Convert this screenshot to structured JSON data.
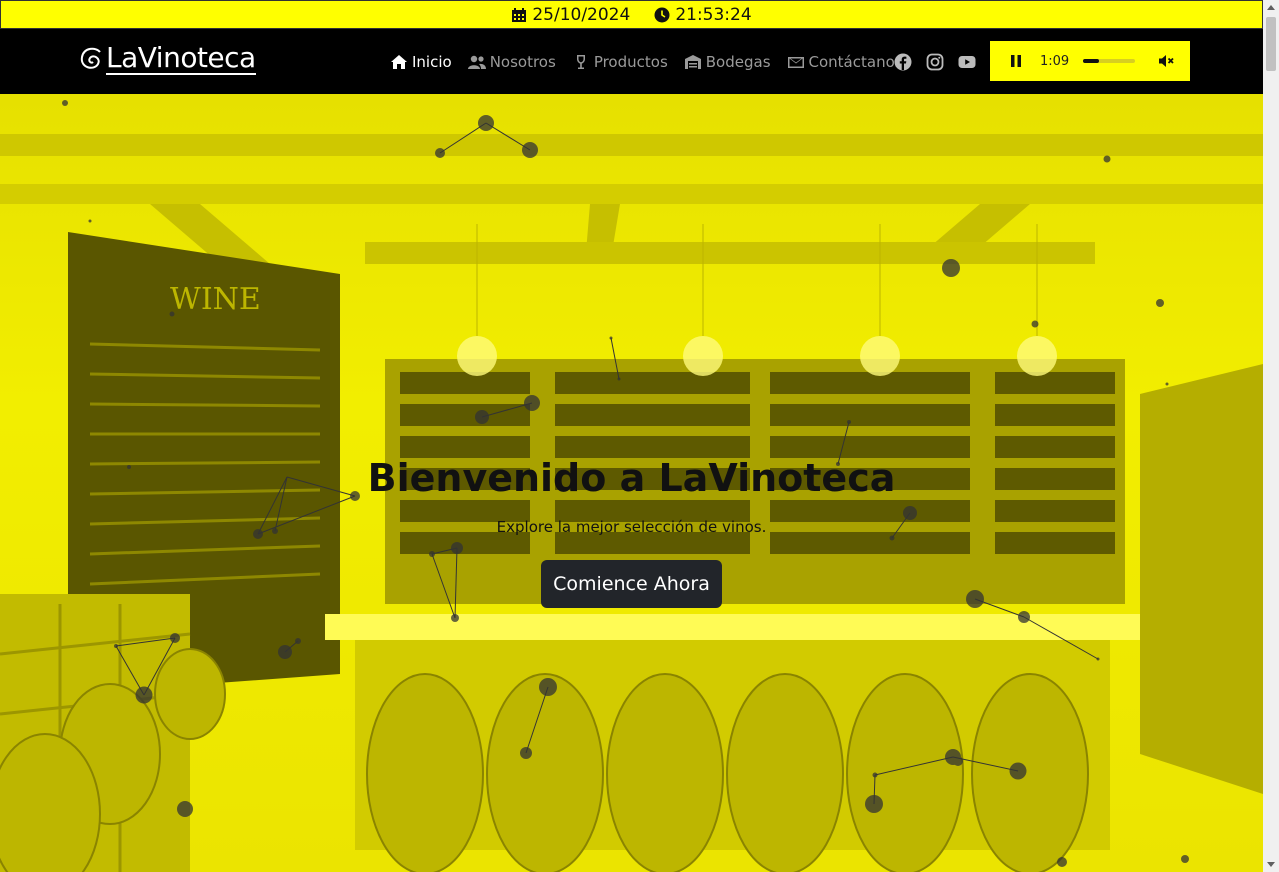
{
  "topbar": {
    "date": "25/10/2024",
    "time": "21:53:24",
    "date_icon": "calendar-icon",
    "time_icon": "clock-icon"
  },
  "brand": {
    "logo_text": "LaVinoteca"
  },
  "nav": {
    "items": [
      {
        "label": "Inicio",
        "icon": "home-icon",
        "active": true
      },
      {
        "label": "Nosotros",
        "icon": "users-icon",
        "active": false
      },
      {
        "label": "Productos",
        "icon": "wine-glass-icon",
        "active": false
      },
      {
        "label": "Bodegas",
        "icon": "warehouse-icon",
        "active": false
      },
      {
        "label": "Contáctanos",
        "icon": "envelope-icon",
        "active": false
      }
    ],
    "social": [
      "facebook-icon",
      "instagram-icon",
      "youtube-icon"
    ]
  },
  "player": {
    "time": "1:09",
    "progress": 0.3,
    "state": "playing",
    "muted": true
  },
  "hero": {
    "title": "Bienvenido a LaVinoteca",
    "subtitle": "Explore la mejor selección de vinos.",
    "cta_label": "Comience Ahora"
  },
  "colors": {
    "accent": "#ffff00",
    "navbar": "#000000",
    "button": "#22252a"
  }
}
